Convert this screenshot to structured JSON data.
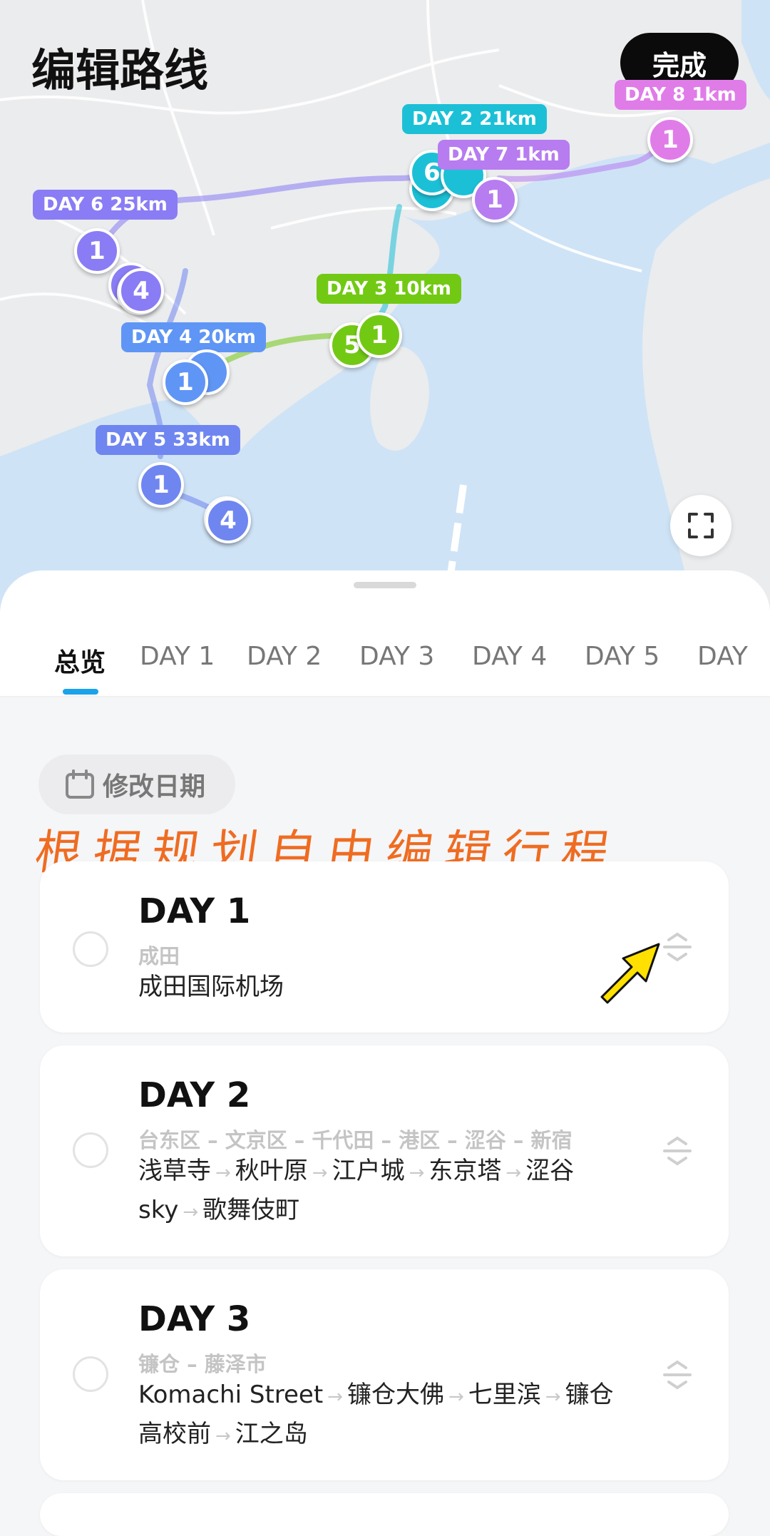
{
  "header": {
    "title": "编辑路线",
    "done_label": "完成"
  },
  "map": {
    "route_labels": [
      {
        "id": "d2",
        "text": "DAY 2 21km",
        "color": "#1cc0d6"
      },
      {
        "id": "d3",
        "text": "DAY 3 10km",
        "color": "#72c914"
      },
      {
        "id": "d4",
        "text": "DAY 4 20km",
        "color": "#5f96f5"
      },
      {
        "id": "d5",
        "text": "DAY 5 33km",
        "color": "#6f86f0"
      },
      {
        "id": "d6",
        "text": "DAY 6 25km",
        "color": "#8a7cf4"
      },
      {
        "id": "d7",
        "text": "DAY 7 1km",
        "color": "#b77cf0"
      },
      {
        "id": "d8",
        "text": "DAY 8 1km",
        "color": "#e07ce8"
      }
    ],
    "pins": [
      {
        "id": "p6a",
        "text": "1",
        "color": "#8a7cf4"
      },
      {
        "id": "p6b",
        "text": "4",
        "color": "#8a7cf4"
      },
      {
        "id": "p4",
        "text": "1",
        "color": "#5f96f5"
      },
      {
        "id": "p5a",
        "text": "1",
        "color": "#6f86f0"
      },
      {
        "id": "p5b",
        "text": "4",
        "color": "#6f86f0"
      },
      {
        "id": "p3a",
        "text": "5",
        "color": "#72c914"
      },
      {
        "id": "p3b",
        "text": "1",
        "color": "#72c914"
      },
      {
        "id": "p2",
        "text": "6",
        "color": "#1cc0d6"
      },
      {
        "id": "p7",
        "text": "1",
        "color": "#b77cf0"
      },
      {
        "id": "p8",
        "text": "1",
        "color": "#e07ce8"
      }
    ],
    "fullscreen_icon": "fullscreen-icon"
  },
  "tabs": [
    {
      "label": "总览",
      "active": true
    },
    {
      "label": "DAY 1"
    },
    {
      "label": "DAY 2"
    },
    {
      "label": "DAY 3"
    },
    {
      "label": "DAY 4"
    },
    {
      "label": "DAY 5"
    },
    {
      "label": "DAY"
    }
  ],
  "date_chip": {
    "label": "修改日期",
    "icon": "calendar-icon"
  },
  "annotation": "根据规划自由编辑行程",
  "days": [
    {
      "title": "DAY 1",
      "area": "成田",
      "spots": [
        "成田国际机场"
      ]
    },
    {
      "title": "DAY 2",
      "area": "台东区 – 文京区 – 千代田 – 港区 – 涩谷 – 新宿",
      "spots": [
        "浅草寺",
        "秋叶原",
        "江户城",
        "东京塔",
        "涩谷sky",
        "歌舞伎町"
      ]
    },
    {
      "title": "DAY 3",
      "area": "镰仓 – 藤泽市",
      "spots": [
        "Komachi Street",
        "镰仓大佛",
        "七里滨",
        "镰仓高校前",
        "江之岛"
      ]
    }
  ],
  "colors": {
    "accent": "#1aa3ea",
    "annotation": "#ef6c21",
    "water": "#cfe3f6",
    "land": "#ebecee"
  }
}
